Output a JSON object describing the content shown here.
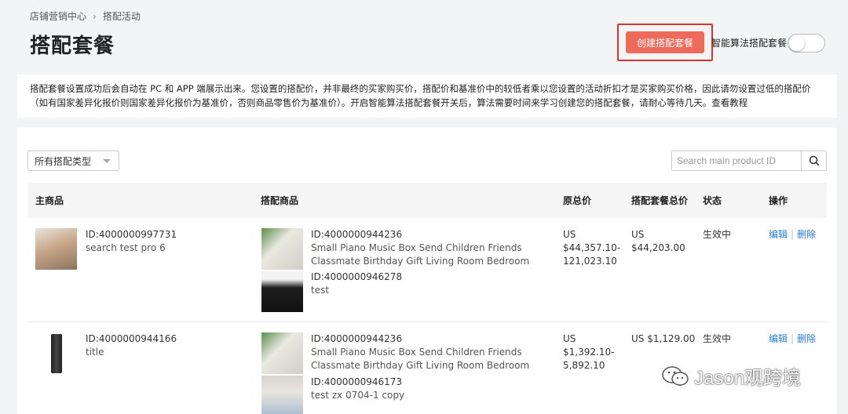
{
  "breadcrumb": {
    "root": "店铺营销中心",
    "current": "搭配活动"
  },
  "page_title": "搭配套餐",
  "create_button": "创建搭配套餐",
  "algo_toggle": {
    "label": "智能算法搭配套餐",
    "on": false
  },
  "notice": {
    "line1": "搭配套餐设置成功后会自动在 PC 和 APP 端展示出来。您设置的搭配价，并非最终的买家购买价，搭配价和基准价中的较低者乘以您设置的活动折扣才是买家购买价格，因此请勿设置过低的搭配价",
    "line2": "（如有国家差异化报价则国家差异化报价为基准价，否则商品零售价为基准价）。开启智能算法搭配套餐开关后，算法需要时间来学习创建您的搭配套餐，请耐心等待几天。查看教程"
  },
  "filter": {
    "selected": "所有搭配类型"
  },
  "search": {
    "placeholder": "Search main product ID"
  },
  "table": {
    "headers": {
      "main": "主商品",
      "matched": "搭配商品",
      "original": "原总价",
      "bundle": "搭配套餐总价",
      "status": "状态",
      "actions": "操作"
    },
    "rows": [
      {
        "main_id": "ID:4000000997731",
        "main_title": "search test pro 6",
        "item1_id": "ID:4000000944236",
        "item1_title_a": "Small Piano Music Box Send Children Friends",
        "item1_title_b": "Classmate Birthday Gift Living Room Bedroom",
        "item2_id": "ID:4000000946278",
        "item2_title": "test",
        "orig_currency": "US",
        "orig_price_a": "$44,357.10-",
        "orig_price_b": "121,023.10",
        "bundle_currency": "US",
        "bundle_price": "$44,203.00",
        "status": "生效中",
        "edit": "编辑",
        "delete": "删除"
      },
      {
        "main_id": "ID:4000000944166",
        "main_title": "title",
        "item1_id": "ID:4000000944236",
        "item1_title_a": "Small Piano Music Box Send Children Friends",
        "item1_title_b": "Classmate Birthday Gift Living Room Bedroom",
        "item2_id": "ID:4000000946173",
        "item2_title": "test zx 0704-1 copy",
        "orig_currency": "US",
        "orig_price_a": "$1,392.10-",
        "orig_price_b": "5,892.10",
        "bundle_price": "US $1,129.00",
        "status": "生效中",
        "edit": "编辑",
        "delete": "删除"
      }
    ]
  },
  "watermark": "Jason观跨境",
  "colors": {
    "primary_button": "#ee6b5b",
    "highlight_border": "#d9342b",
    "link": "#2a7fd4"
  }
}
